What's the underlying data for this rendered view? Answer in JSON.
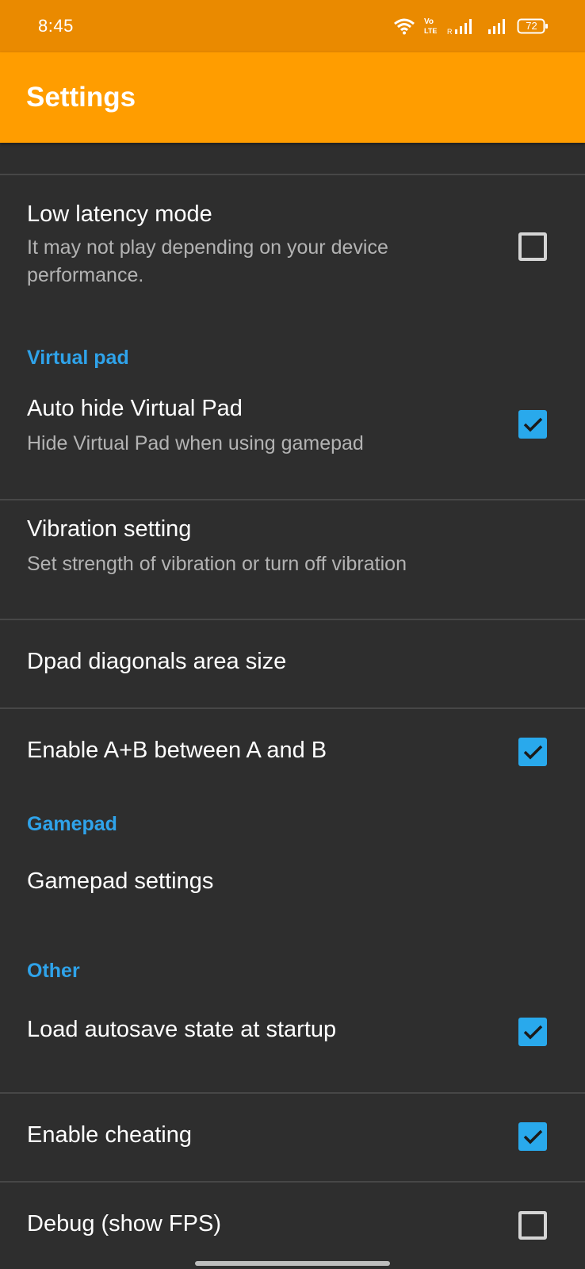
{
  "status_bar": {
    "time": "8:45",
    "battery": "72",
    "icons": [
      "wifi-icon",
      "volte-icon",
      "signal-icon",
      "battery-icon"
    ]
  },
  "app_bar": {
    "title": "Settings"
  },
  "settings": {
    "low_latency": {
      "title": "Low latency mode",
      "summary": "It may not play depending on your device performance.",
      "checked": false
    },
    "virtual_pad_category": "Virtual pad",
    "auto_hide": {
      "title": "Auto hide Virtual Pad",
      "summary": "Hide Virtual Pad when using gamepad",
      "checked": true
    },
    "vibration": {
      "title": "Vibration setting",
      "summary": "Set strength of vibration or turn off vibration"
    },
    "dpad": {
      "title": "Dpad diagonals area size"
    },
    "enable_ab": {
      "title": "Enable A+B between A and B",
      "checked": true
    },
    "gamepad_category": "Gamepad",
    "gamepad_settings": {
      "title": "Gamepad settings"
    },
    "other_category": "Other",
    "load_autosave": {
      "title": "Load autosave state at startup",
      "checked": true
    },
    "enable_cheating": {
      "title": "Enable cheating",
      "checked": true
    },
    "debug_fps": {
      "title": "Debug (show FPS)",
      "checked": false
    }
  },
  "colors": {
    "status_bar": "#ea8a00",
    "app_bar": "#ff9d00",
    "background": "#2e2e2e",
    "accent": "#29a9ec",
    "category_text": "#2fa3ea"
  }
}
